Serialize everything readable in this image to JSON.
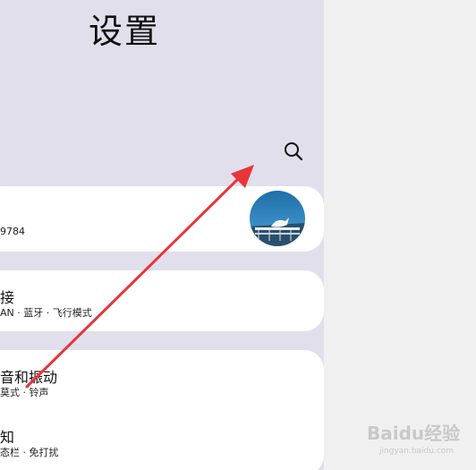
{
  "header": {
    "title": "设置"
  },
  "search": {
    "icon": "search-icon"
  },
  "account": {
    "number_tail": "9784",
    "avatar_icon": "profile-photo"
  },
  "connections": {
    "title": "接",
    "subtitle": "AN · 蓝牙 · 飞行模式"
  },
  "sound": {
    "title": "音和振动",
    "subtitle": "莫式 · 铃声"
  },
  "notifications": {
    "title": "知",
    "subtitle": "态栏 · 免打扰"
  },
  "watermark": {
    "brand": "Baidu经验",
    "url": "jingyan.baidu.com"
  },
  "colors": {
    "screen_bg": "#e1dfeb",
    "card_bg": "#ffffff",
    "arrow": "#e8353a",
    "outside_bg": "#f0f0f0"
  }
}
